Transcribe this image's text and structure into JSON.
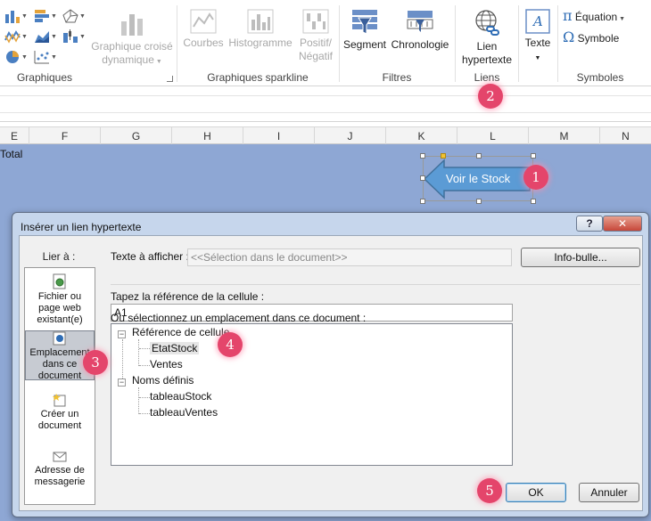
{
  "ribbon": {
    "groups": {
      "graphiques": "Graphiques",
      "sparkline": "Graphiques sparkline",
      "filtres": "Filtres",
      "liens": "Liens",
      "symboles": "Symboles"
    },
    "graphique_croise": {
      "line1": "Graphique croisé",
      "line2": "dynamique"
    },
    "courbes": "Courbes",
    "histogramme": "Histogramme",
    "positif": {
      "line1": "Positif/",
      "line2": "Négatif"
    },
    "segment": "Segment",
    "chronologie": "Chronologie",
    "lien": {
      "line1": "Lien",
      "line2": "hypertexte"
    },
    "texte": "Texte",
    "equation": "Équation",
    "symbole": "Symbole"
  },
  "sheet": {
    "columns": [
      "E",
      "F",
      "G",
      "H",
      "I",
      "J",
      "K",
      "L",
      "M",
      "N"
    ],
    "cell_total": "Total",
    "shape_text": "Voir le Stock"
  },
  "badges": [
    "1",
    "2",
    "3",
    "4",
    "5"
  ],
  "dialog": {
    "title": "Insérer un lien hypertexte",
    "help": "?",
    "close": "✕",
    "lier_a": "Lier à :",
    "link_types": [
      {
        "line1": "Fichier ou",
        "line2": "page web",
        "line3": "existant(e)"
      },
      {
        "line1": "Emplacement",
        "line2": "dans ce",
        "line3": "document"
      },
      {
        "line1": "Créer un",
        "line2": "document"
      },
      {
        "line1": "Adresse de",
        "line2": "messagerie"
      }
    ],
    "texte_afficher_label": "Texte à afficher :",
    "texte_afficher_value": "<<Sélection dans le document>>",
    "infobulle": "Info-bulle...",
    "ref_label": "Tapez la référence de la cellule :",
    "ref_value": "A1",
    "emplacement_label": "Ou sélectionnez un emplacement dans ce document :",
    "tree": {
      "ref_cellule": "Référence de cellule",
      "etat_stock": "EtatStock",
      "ventes": "Ventes",
      "noms_definis": "Noms définis",
      "tableau_stock": "tableauStock",
      "tableau_ventes": "tableauVentes"
    },
    "ok": "OK",
    "annuler": "Annuler"
  },
  "colors": {
    "sheet_bg": "#8ea7d4",
    "arrow_fill": "#5b9bd5",
    "badge": "#e4456b",
    "dialog_frame": "#c6d6ec"
  }
}
